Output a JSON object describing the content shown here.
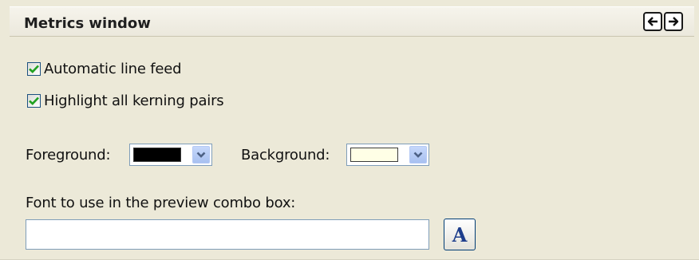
{
  "header": {
    "title": "Metrics window",
    "prev_icon": "arrow-left-icon",
    "next_icon": "arrow-right-icon"
  },
  "options": {
    "auto_line_feed": {
      "label": "Automatic line feed",
      "checked": true
    },
    "highlight_kerning": {
      "label": "Highlight all kerning pairs",
      "checked": true
    }
  },
  "colors": {
    "foreground_label": "Foreground:",
    "foreground_value": "#000000",
    "background_label": "Background:",
    "background_value": "#ffffe6"
  },
  "preview_font": {
    "label": "Font to use in the preview combo box:",
    "value": "",
    "button_glyph": "A"
  },
  "theme": {
    "panel_bg": "#ece9d8",
    "check_color": "#21a121",
    "combo_arrow_color": "#4d6185"
  }
}
